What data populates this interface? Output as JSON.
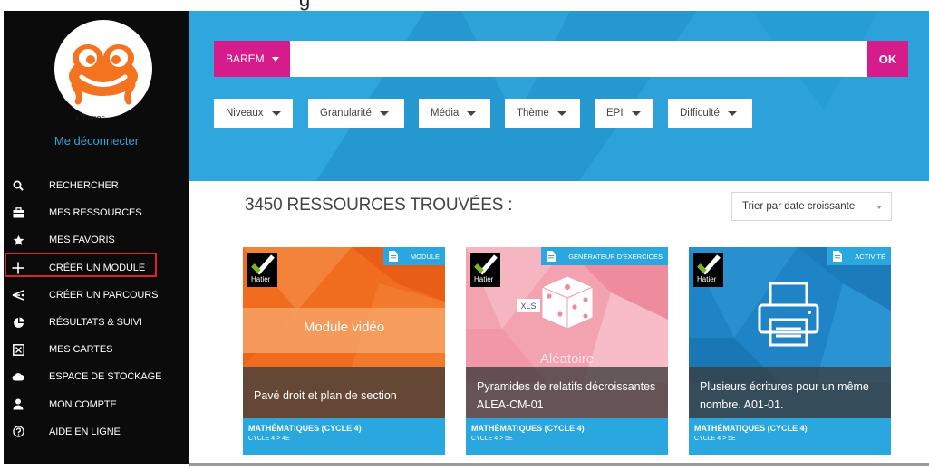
{
  "top_strip": {
    "partial_text": "g"
  },
  "sidebar": {
    "logout_label": "Me déconnecter",
    "username_shadow": "L.Lanes",
    "items": [
      {
        "label": "RECHERCHER",
        "icon": "search-icon"
      },
      {
        "label": "MES RESSOURCES",
        "icon": "briefcase-icon"
      },
      {
        "label": "MES FAVORIS",
        "icon": "star-icon"
      },
      {
        "label": "CRÉER UN MODULE",
        "icon": "plus-icon"
      },
      {
        "label": "CRÉER UN PARCOURS",
        "icon": "route-icon"
      },
      {
        "label": "RÉSULTATS & SUIVI",
        "icon": "pie-chart-icon"
      },
      {
        "label": "MES CARTES",
        "icon": "card-icon"
      },
      {
        "label": "ESPACE DE STOCKAGE",
        "icon": "cloud-icon"
      },
      {
        "label": "MON COMPTE",
        "icon": "user-icon"
      },
      {
        "label": "AIDE EN LIGNE",
        "icon": "help-icon"
      }
    ]
  },
  "search": {
    "scope_label": "BAREM",
    "query": "",
    "submit_label": "OK"
  },
  "filters": [
    "Niveaux",
    "Granularité",
    "Média",
    "Thème",
    "EPI",
    "Difficulté"
  ],
  "results": {
    "title": "3450 RESSOURCES TROUVÉES :",
    "sort_label": "Trier par date croissante"
  },
  "cards": [
    {
      "type": "MODULE",
      "brand": "Hatier",
      "art_text": "Module vidéo",
      "title": "Pavé droit et plan de section",
      "subject": "MATHÉMATIQUES (CYCLE 4)",
      "level": "CYCLE 4 > 4E"
    },
    {
      "type": "GÉNÉRATEUR D'EXERCICES",
      "brand": "Hatier",
      "art_text": "Aléatoire",
      "art_badge": "XLS",
      "title": "Pyramides de relatifs décroissantes ALEA-CM-01",
      "subject": "MATHÉMATIQUES (CYCLE 4)",
      "level": "CYCLE 4 > 5E"
    },
    {
      "type": "ACTIVITÉ",
      "brand": "Hatier",
      "art_text": "",
      "title": "Plusieurs écritures pour un même nombre. A01-01.",
      "subject": "MATHÉMATIQUES (CYCLE 4)",
      "level": "CYCLE 4 > 5E"
    }
  ],
  "colors": {
    "sidebar_bg": "#0b0b0b",
    "accent_blue": "#2aa7de",
    "hero_blue": "#2a9fd8",
    "magenta": "#d51c8a",
    "logo_orange": "#f47321",
    "highlight_red": "#e0202a"
  }
}
